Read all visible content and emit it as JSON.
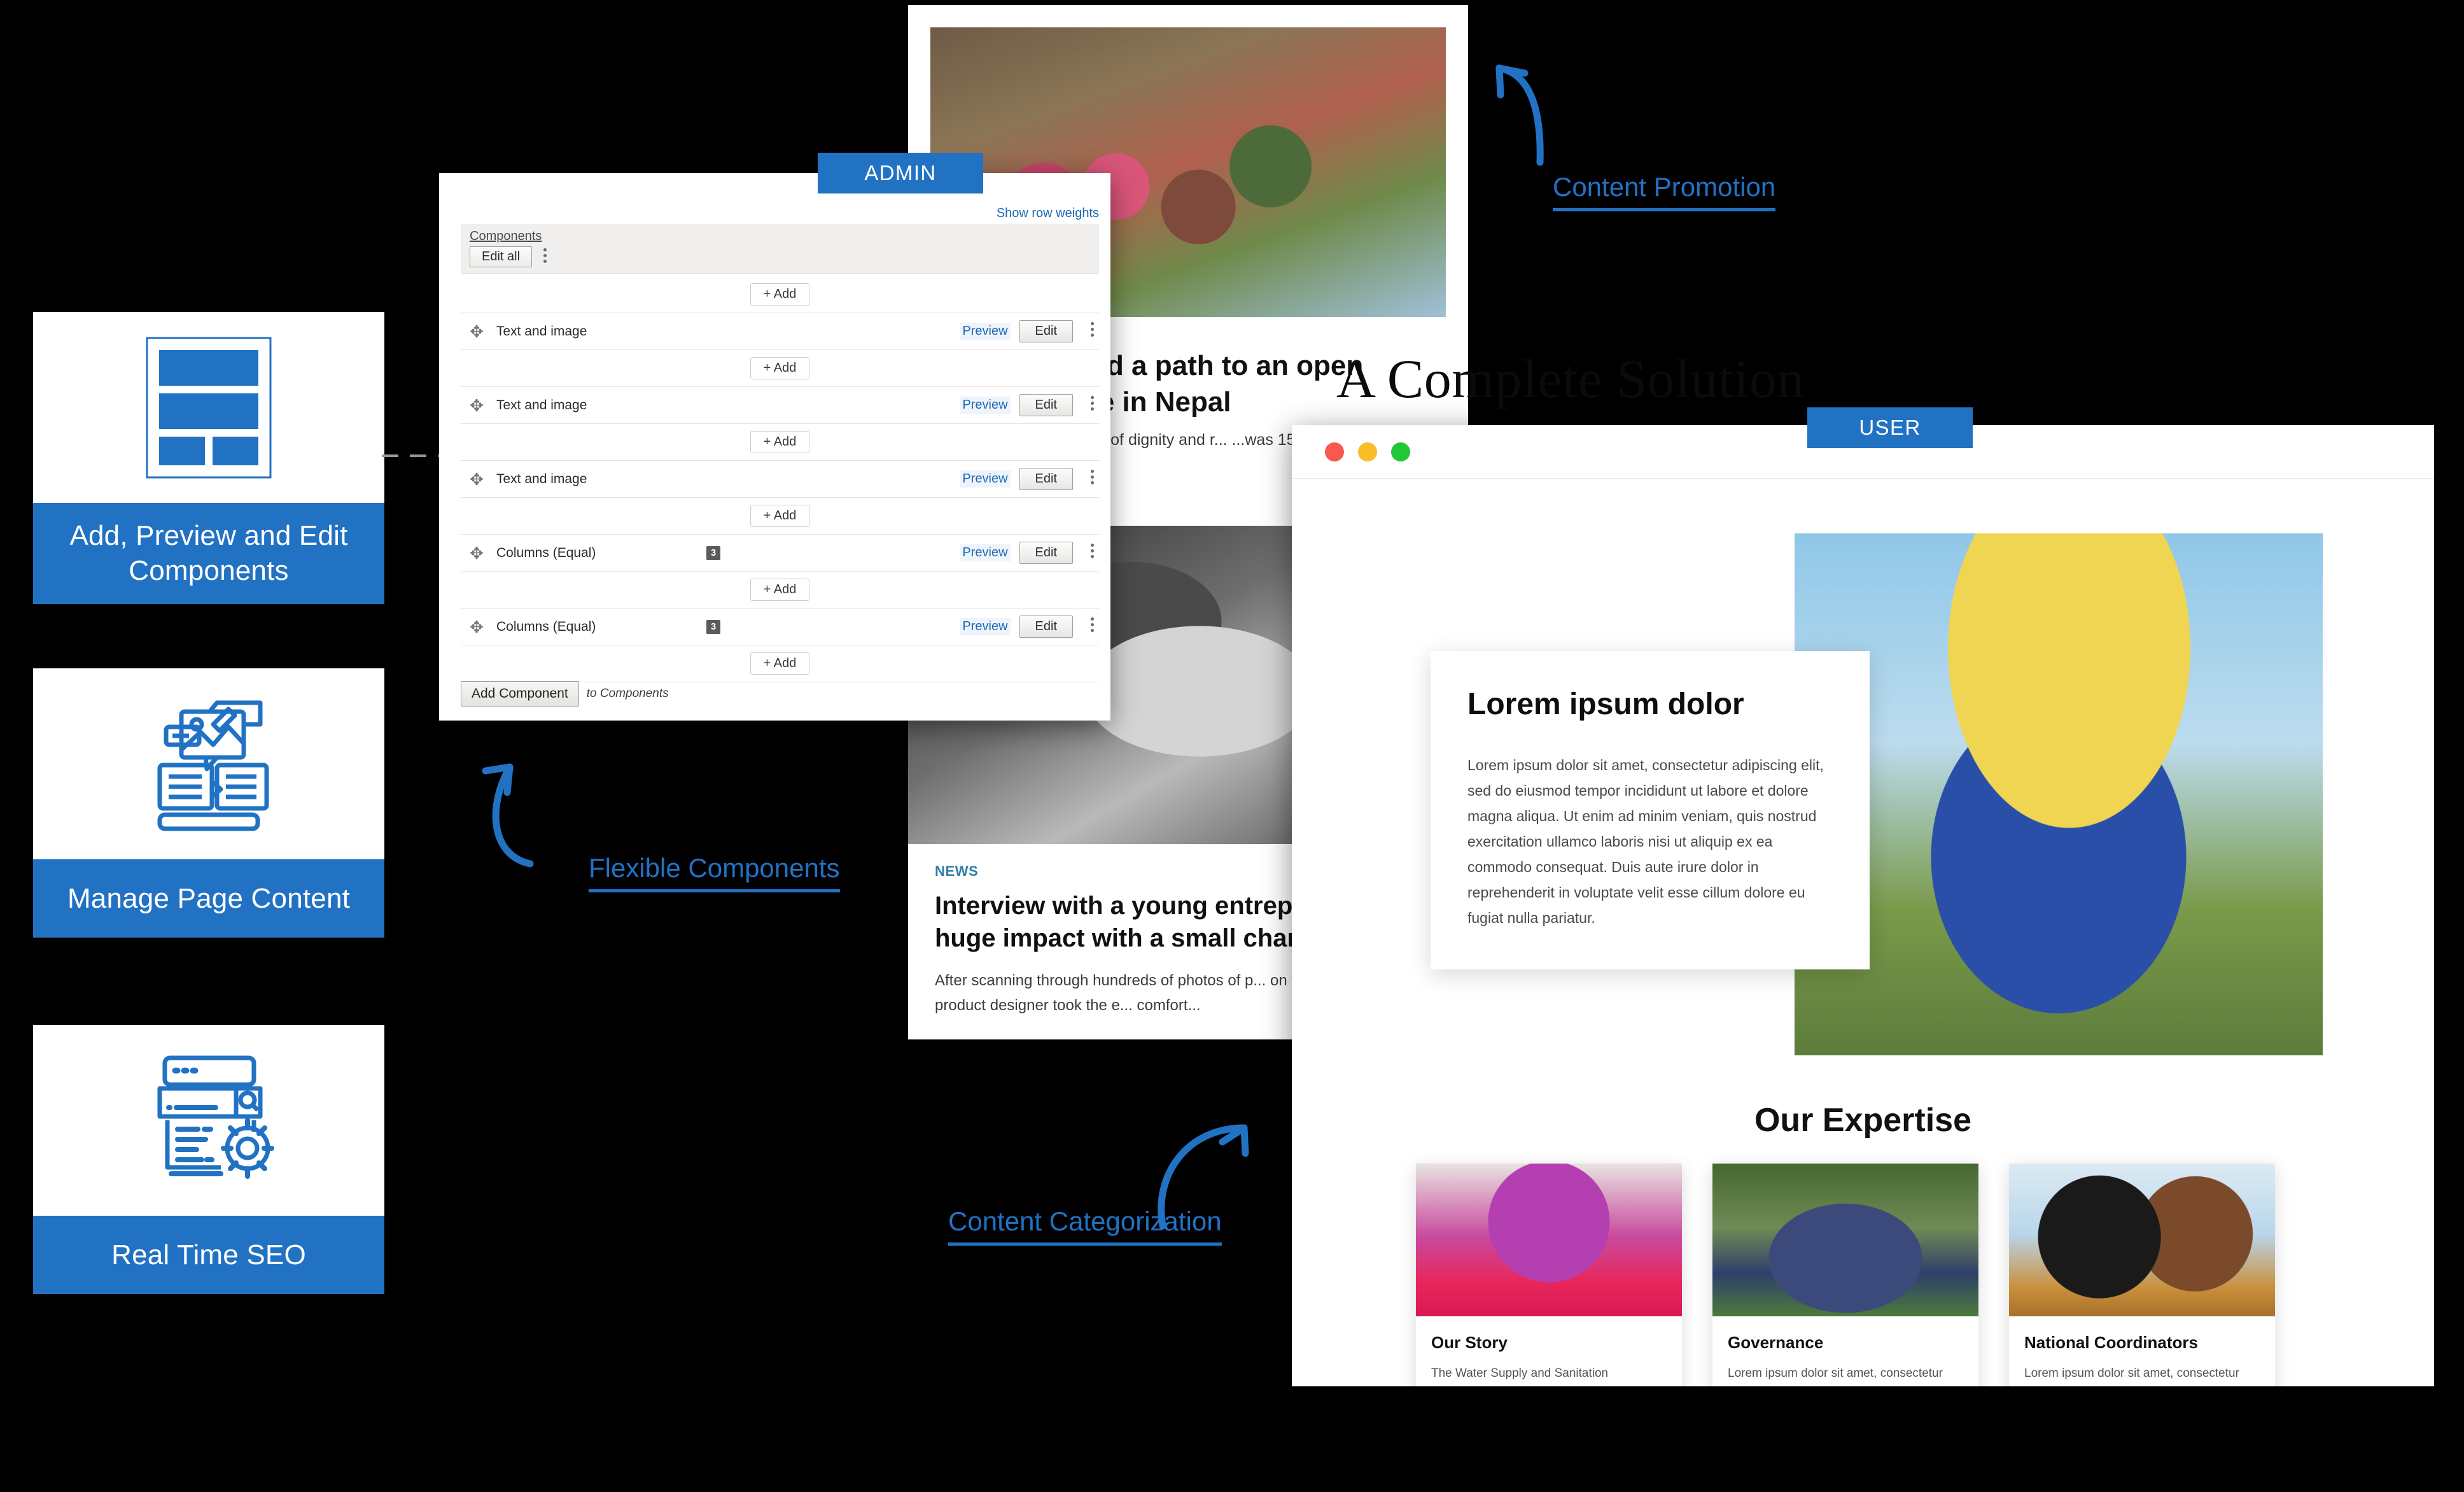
{
  "feature_cards": [
    {
      "icon": "layout-blocks-icon",
      "label": "Add, Preview and Edit Components"
    },
    {
      "icon": "manage-content-icon",
      "label": "Manage Page Content"
    },
    {
      "icon": "seo-gear-icon",
      "label": "Real Time SEO"
    }
  ],
  "badges": {
    "admin": "ADMIN",
    "user": "USER"
  },
  "admin": {
    "show_row_weights": "Show row weights",
    "components_label": "Components",
    "edit_all": "Edit all",
    "add_label": "+ Add",
    "preview_label": "Preview",
    "edit_label": "Edit",
    "add_component": "Add Component",
    "add_component_suffix": "to Components",
    "rows": [
      {
        "name": "Text and image",
        "count": ""
      },
      {
        "name": "Text and image",
        "count": ""
      },
      {
        "name": "Text and image",
        "count": ""
      },
      {
        "name": "Columns (Equal)",
        "count": "3"
      },
      {
        "name": "Columns (Equal)",
        "count": "3"
      }
    ]
  },
  "article": {
    "title": "...en led a path to an open ...illage in Nepal",
    "subtitle": "...a question of dignity and r... ...was 15 years ago when 1...",
    "news_kicker": "NEWS",
    "news_title": "Interview with a young entrepreneur... a huge impact with a small change",
    "news_body": "After scanning through hundreds of photos of p... on toilets, an Indian product designer took the e... comfort...",
    "overlay_heading": "A Complete Solution"
  },
  "user_site": {
    "lorem_title": "Lorem ipsum dolor",
    "lorem_body": "Lorem ipsum dolor sit amet, consectetur adipiscing elit, sed do eiusmod tempor incididunt ut labore et dolore magna aliqua. Ut enim ad minim veniam, quis nostrud exercitation ullamco laboris nisi ut aliquip ex ea commodo consequat. Duis aute irure dolor in reprehenderit in voluptate velit esse cillum dolore eu fugiat nulla pariatur.",
    "expertise_heading": "Our Expertise",
    "expertise_cards": [
      {
        "title": "Our Story",
        "body": "The Water Supply and Sanitation Collaborative Council (WSSCC) is a global, multi-stakeholder membership and partnership-based"
      },
      {
        "title": "Governance",
        "body": "Lorem ipsum dolor sit amet, consectetur adipiscing elit. Duis molestie molestie libero vitae malesuada. Vestibulum imperdiet ut magna ut molestie."
      },
      {
        "title": "National Coordinators",
        "body": "Lorem ipsum dolor sit amet, consectetur adipiscing elit. Duis molestie molestie libero vitae malesuada. Vestibulum imperdiet ut magna ut molestie."
      }
    ]
  },
  "annotations": [
    {
      "label": "Content Promotion"
    },
    {
      "label": "Flexible Components"
    },
    {
      "label": "Content Categorization"
    }
  ],
  "colors": {
    "accent": "#2272c4",
    "link": "#1c68b3",
    "news_kicker": "#2f7ea8"
  }
}
